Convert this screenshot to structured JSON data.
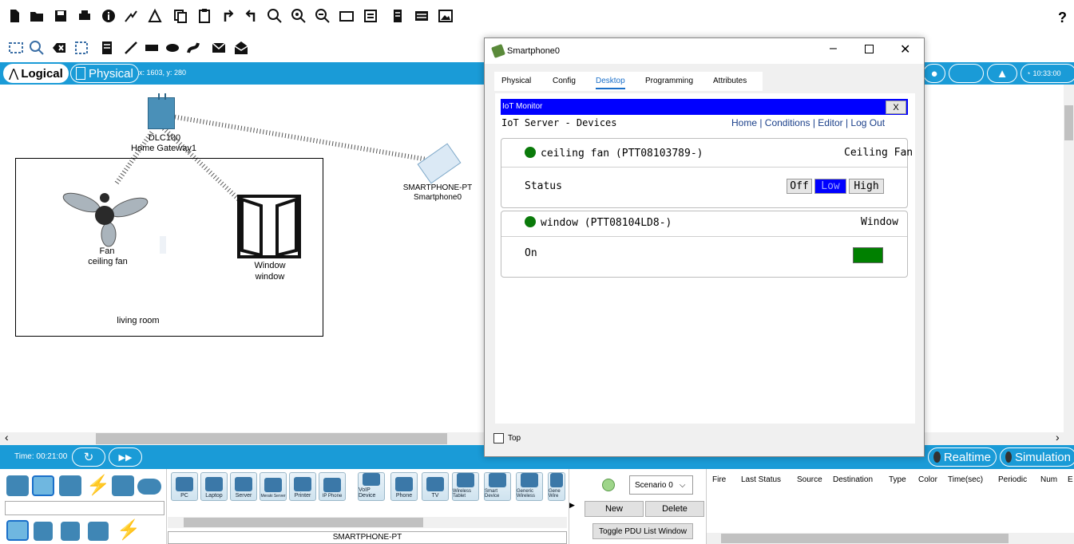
{
  "toolbar": {
    "help": "?"
  },
  "bluebar": {
    "logical": "Logical",
    "physical": "Physical",
    "coords": "x: 1603, y: 280",
    "clock": "10:33:00"
  },
  "workspace": {
    "gateway_label_1": "DLC100",
    "gateway_label_2": "Home Gateway1",
    "phone_label_1": "SMARTPHONE-PT",
    "phone_label_2": "Smartphone0",
    "fan_label_1": "Fan",
    "fan_label_2": "ceiling fan",
    "window_label_1": "Window",
    "window_label_2": "window",
    "room_label": "living room"
  },
  "timebar": {
    "time": "Time: 00:21:00",
    "realtime": "Realtime",
    "simulation": "Simulation"
  },
  "bottom": {
    "devices": [
      "PC",
      "Laptop",
      "Server",
      "Meraki Server",
      "Printer",
      "IP Phone",
      "VoIP Device",
      "Phone",
      "TV",
      "Wireless Tablet",
      "Smart Device",
      "Generic Wireless",
      "Gene Wire"
    ],
    "selected_device": "SMARTPHONE-PT",
    "scenario": "Scenario 0",
    "new_btn": "New",
    "delete_btn": "Delete",
    "toggle_btn": "Toggle PDU List Window",
    "columns": [
      "Fire",
      "Last Status",
      "Source",
      "Destination",
      "Type",
      "Color",
      "Time(sec)",
      "Periodic",
      "Num",
      "E"
    ]
  },
  "window": {
    "title": "Smartphone0",
    "tabs": [
      "Physical",
      "Config",
      "Desktop",
      "Programming",
      "Attributes"
    ],
    "top_checkbox": "Top"
  },
  "iot": {
    "bar_title": "IoT Monitor",
    "close": "X",
    "page_title": "IoT Server - Devices",
    "nav": "Home | Conditions | Editor | Log Out",
    "devices": [
      {
        "name": "ceiling fan (PTT08103789-)",
        "type": "Ceiling Fan",
        "field": "Status",
        "levels": [
          "Off",
          "Low",
          "High"
        ],
        "selected_level": "Low"
      },
      {
        "name": "window (PTT08104LD8-)",
        "type": "Window",
        "field": "On",
        "state_color": "#008000"
      }
    ]
  },
  "colors": {
    "accent_blue": "#1a9bd7",
    "iot_blue": "#0000ff",
    "status_green": "#0a7a0a"
  }
}
